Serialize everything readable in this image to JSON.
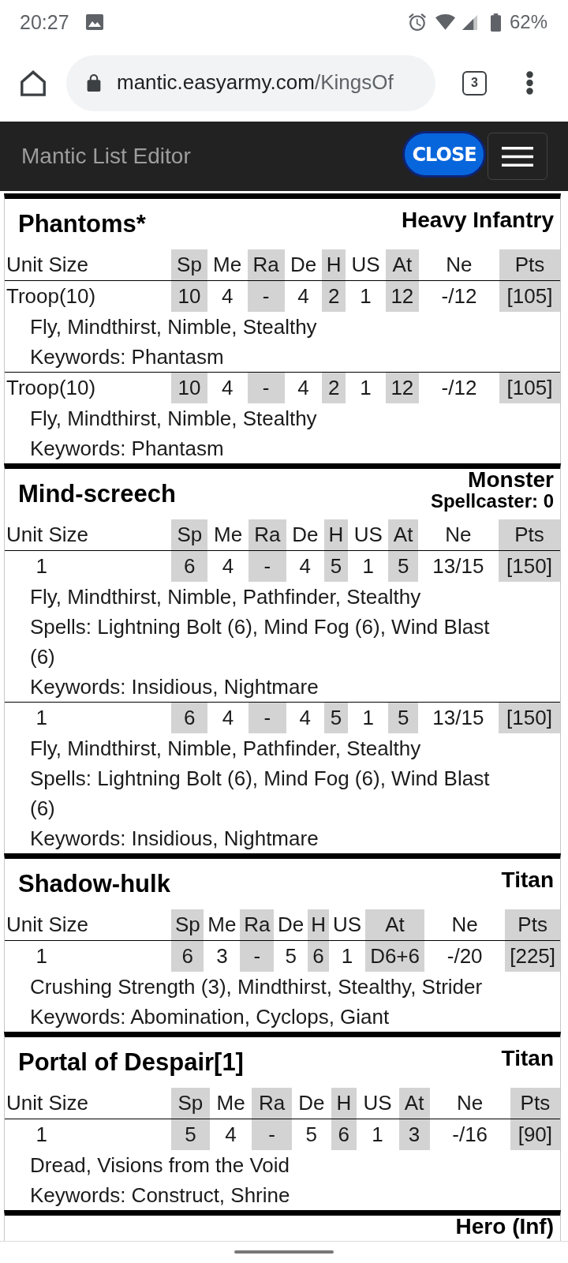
{
  "status_bar": {
    "time": "20:27",
    "battery": "62%"
  },
  "browser": {
    "url_host": "mantic.easyarmy.com",
    "url_path": "/KingsOf",
    "tab_count": "3"
  },
  "navbar": {
    "brand": "Mantic List Editor",
    "close_button": "CLOSE"
  },
  "units": [
    {
      "name": "Phantoms*",
      "type": "Heavy Infantry",
      "columns": [
        {
          "label": "Unit Size",
          "shaded": false
        },
        {
          "label": "Sp",
          "shaded": true
        },
        {
          "label": "Me",
          "shaded": false
        },
        {
          "label": "Ra",
          "shaded": true
        },
        {
          "label": "De",
          "shaded": false
        },
        {
          "label": "H",
          "shaded": true
        },
        {
          "label": "US",
          "shaded": false
        },
        {
          "label": "At",
          "shaded": true
        },
        {
          "label": "Ne",
          "shaded": false
        },
        {
          "label": "Pts",
          "shaded": true
        }
      ],
      "rows": [
        {
          "unit_size": "Troop(10)",
          "stats": [
            "10",
            "4",
            "-",
            "4",
            "2",
            "1",
            "12",
            "-/12",
            "[105]"
          ],
          "notes": [
            "Fly, Mindthirst, Nimble, Stealthy",
            "Keywords: Phantasm"
          ]
        },
        {
          "unit_size": "Troop(10)",
          "stats": [
            "10",
            "4",
            "-",
            "4",
            "2",
            "1",
            "12",
            "-/12",
            "[105]"
          ],
          "notes": [
            "Fly, Mindthirst, Nimble, Stealthy",
            "Keywords: Phantasm"
          ]
        }
      ]
    },
    {
      "name": "Mind-screech",
      "type": "Monster",
      "spellcaster": "Spellcaster: 0",
      "columns": [
        {
          "label": "Unit Size",
          "shaded": false
        },
        {
          "label": "Sp",
          "shaded": true
        },
        {
          "label": "Me",
          "shaded": false
        },
        {
          "label": "Ra",
          "shaded": true
        },
        {
          "label": "De",
          "shaded": false
        },
        {
          "label": "H",
          "shaded": true
        },
        {
          "label": "US",
          "shaded": false
        },
        {
          "label": "At",
          "shaded": true
        },
        {
          "label": "Ne",
          "shaded": false
        },
        {
          "label": "Pts",
          "shaded": true
        }
      ],
      "rows": [
        {
          "unit_size": "1",
          "stats": [
            "6",
            "4",
            "-",
            "4",
            "5",
            "1",
            "5",
            "13/15",
            "[150]"
          ],
          "notes": [
            "Fly, Mindthirst, Nimble, Pathfinder, Stealthy",
            "Spells: Lightning Bolt (6), Mind Fog (6), Wind Blast (6)",
            "Keywords: Insidious, Nightmare"
          ]
        },
        {
          "unit_size": "1",
          "stats": [
            "6",
            "4",
            "-",
            "4",
            "5",
            "1",
            "5",
            "13/15",
            "[150]"
          ],
          "notes": [
            "Fly, Mindthirst, Nimble, Pathfinder, Stealthy",
            "Spells: Lightning Bolt (6), Mind Fog (6), Wind Blast (6)",
            "Keywords: Insidious, Nightmare"
          ]
        }
      ]
    },
    {
      "name": "Shadow-hulk",
      "type": "Titan",
      "columns": [
        {
          "label": "Unit Size",
          "shaded": false
        },
        {
          "label": "Sp",
          "shaded": true
        },
        {
          "label": "Me",
          "shaded": false
        },
        {
          "label": "Ra",
          "shaded": true
        },
        {
          "label": "De",
          "shaded": false
        },
        {
          "label": "H",
          "shaded": true
        },
        {
          "label": "US",
          "shaded": false
        },
        {
          "label": "At",
          "shaded": true
        },
        {
          "label": "Ne",
          "shaded": false
        },
        {
          "label": "Pts",
          "shaded": true
        }
      ],
      "rows": [
        {
          "unit_size": "1",
          "stats": [
            "6",
            "3",
            "-",
            "5",
            "6",
            "1",
            "D6+6",
            "-/20",
            "[225]"
          ],
          "notes": [
            "Crushing Strength (3), Mindthirst, Stealthy, Strider",
            "Keywords: Abomination, Cyclops, Giant"
          ]
        }
      ]
    },
    {
      "name": "Portal of Despair[1]",
      "type": "Titan",
      "columns": [
        {
          "label": "Unit Size",
          "shaded": false
        },
        {
          "label": "Sp",
          "shaded": true
        },
        {
          "label": "Me",
          "shaded": false
        },
        {
          "label": "Ra",
          "shaded": true
        },
        {
          "label": "De",
          "shaded": false
        },
        {
          "label": "H",
          "shaded": true
        },
        {
          "label": "US",
          "shaded": false
        },
        {
          "label": "At",
          "shaded": true
        },
        {
          "label": "Ne",
          "shaded": false
        },
        {
          "label": "Pts",
          "shaded": true
        }
      ],
      "rows": [
        {
          "unit_size": "1",
          "stats": [
            "5",
            "4",
            "-",
            "5",
            "6",
            "1",
            "3",
            "-/16",
            "[90]"
          ],
          "notes": [
            "Dread, Visions from the Void",
            "Keywords: Construct, Shrine"
          ]
        }
      ]
    },
    {
      "type": "Hero (Inf)"
    }
  ]
}
